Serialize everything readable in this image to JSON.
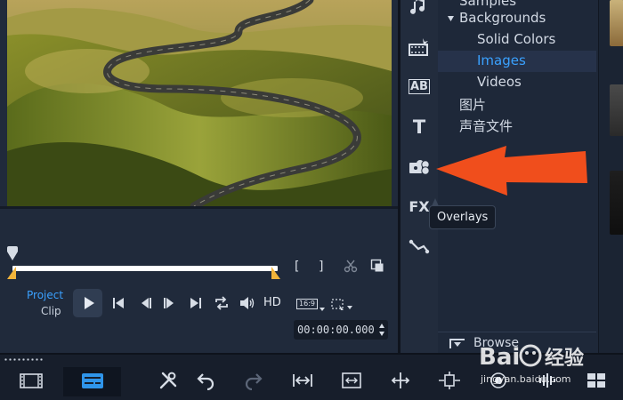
{
  "library": {
    "items": [
      {
        "label": "Samples",
        "indent": 1
      },
      {
        "label": "Backgrounds",
        "indent": 0,
        "expanded": true
      },
      {
        "label": "Solid Colors",
        "indent": 2
      },
      {
        "label": "Images",
        "indent": 2,
        "selected": true
      },
      {
        "label": "Videos",
        "indent": 2
      },
      {
        "label": "图片",
        "indent": 0
      },
      {
        "label": "声音文件",
        "indent": 0
      }
    ],
    "browse_label": "Browse"
  },
  "toolbar": {
    "tools": [
      {
        "name": "audio-icon"
      },
      {
        "name": "transition-icon"
      },
      {
        "name": "title-ab-icon",
        "text": "AB"
      },
      {
        "name": "text-title-icon",
        "text": "T"
      },
      {
        "name": "overlays-icon"
      },
      {
        "name": "fx-filter-icon",
        "text": "FX"
      },
      {
        "name": "motion-path-icon"
      }
    ],
    "tooltip": "Overlays"
  },
  "preview": {
    "mode_project": "Project",
    "mode_clip": "Clip",
    "mark_in": "[",
    "mark_out": "]",
    "hd": "HD",
    "aspect": "16:9",
    "timecode": "00:00:00.000"
  },
  "watermark": {
    "brand": "Bai",
    "brand_cn": "经验",
    "url": "jingyan.baidu.com"
  },
  "colors": {
    "accent": "#3aa1ff",
    "arrow": "#f04e1c",
    "trim": "#f2b43a"
  }
}
